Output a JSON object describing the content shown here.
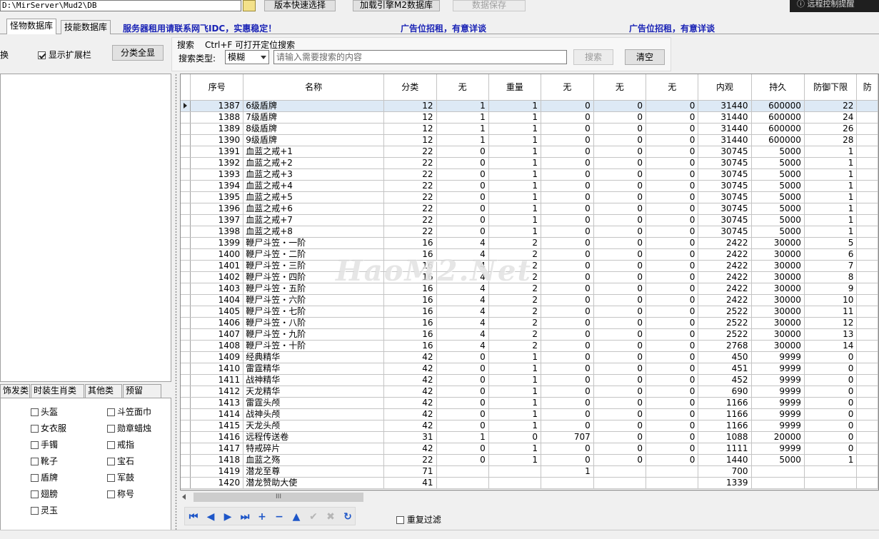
{
  "topbar": {
    "path": "D:\\MirServer\\Mud2\\DB",
    "btn_version": "版本快速选择",
    "btn_load": "加载引擎M2数据库",
    "btn_save": "数据保存",
    "remote": "远程控制提醒"
  },
  "tabs": [
    "怪物数据库",
    "技能数据库"
  ],
  "ads": [
    "服务器租用请联系网飞IDC，实惠稳定！",
    "广告位招租，有意详谈",
    "广告位招租，有意详谈"
  ],
  "toolbar": {
    "swap_label": "换",
    "show_ext_label": "显示扩展栏",
    "show_ext_checked": true,
    "expand_all": "分类全显",
    "search_title": "搜索",
    "search_hint": "Ctrl+F 可打开定位搜索",
    "search_type_label": "搜索类型:",
    "search_type_value": "模糊",
    "search_placeholder": "请输入需要搜索的内容",
    "search_btn": "搜索",
    "clear_btn": "清空"
  },
  "left_tabs": [
    "饰发类",
    "时装生肖类",
    "其他类",
    "预留"
  ],
  "categories": [
    [
      "头盔",
      "斗笠面巾"
    ],
    [
      "女衣服",
      "勋章蜡烛"
    ],
    [
      "手镯",
      "戒指"
    ],
    [
      "靴子",
      "宝石"
    ],
    [
      "盾牌",
      "军鼓"
    ],
    [
      "翅膀",
      "称号"
    ],
    [
      "灵玉",
      ""
    ]
  ],
  "grid": {
    "headers": [
      "序号",
      "名称",
      "分类",
      "无",
      "重量",
      "无",
      "无",
      "无",
      "内观",
      "持久",
      "防御下限",
      "防"
    ],
    "rows": [
      [
        "1387",
        "6级盾牌",
        "12",
        "1",
        "1",
        "0",
        "0",
        "0",
        "31440",
        "600000",
        "22"
      ],
      [
        "1388",
        "7级盾牌",
        "12",
        "1",
        "1",
        "0",
        "0",
        "0",
        "31440",
        "600000",
        "24"
      ],
      [
        "1389",
        "8级盾牌",
        "12",
        "1",
        "1",
        "0",
        "0",
        "0",
        "31440",
        "600000",
        "26"
      ],
      [
        "1390",
        "9级盾牌",
        "12",
        "1",
        "1",
        "0",
        "0",
        "0",
        "31440",
        "600000",
        "28"
      ],
      [
        "1391",
        "血蓝之戒+1",
        "22",
        "0",
        "1",
        "0",
        "0",
        "0",
        "30745",
        "5000",
        "1"
      ],
      [
        "1392",
        "血蓝之戒+2",
        "22",
        "0",
        "1",
        "0",
        "0",
        "0",
        "30745",
        "5000",
        "1"
      ],
      [
        "1393",
        "血蓝之戒+3",
        "22",
        "0",
        "1",
        "0",
        "0",
        "0",
        "30745",
        "5000",
        "1"
      ],
      [
        "1394",
        "血蓝之戒+4",
        "22",
        "0",
        "1",
        "0",
        "0",
        "0",
        "30745",
        "5000",
        "1"
      ],
      [
        "1395",
        "血蓝之戒+5",
        "22",
        "0",
        "1",
        "0",
        "0",
        "0",
        "30745",
        "5000",
        "1"
      ],
      [
        "1396",
        "血蓝之戒+6",
        "22",
        "0",
        "1",
        "0",
        "0",
        "0",
        "30745",
        "5000",
        "1"
      ],
      [
        "1397",
        "血蓝之戒+7",
        "22",
        "0",
        "1",
        "0",
        "0",
        "0",
        "30745",
        "5000",
        "1"
      ],
      [
        "1398",
        "血蓝之戒+8",
        "22",
        "0",
        "1",
        "0",
        "0",
        "0",
        "30745",
        "5000",
        "1"
      ],
      [
        "1399",
        "鞭尸斗笠・一阶",
        "16",
        "4",
        "2",
        "0",
        "0",
        "0",
        "2422",
        "30000",
        "5"
      ],
      [
        "1400",
        "鞭尸斗笠・二阶",
        "16",
        "4",
        "2",
        "0",
        "0",
        "0",
        "2422",
        "30000",
        "6"
      ],
      [
        "1401",
        "鞭尸斗笠・三阶",
        "16",
        "4",
        "2",
        "0",
        "0",
        "0",
        "2422",
        "30000",
        "7"
      ],
      [
        "1402",
        "鞭尸斗笠・四阶",
        "16",
        "4",
        "2",
        "0",
        "0",
        "0",
        "2422",
        "30000",
        "8"
      ],
      [
        "1403",
        "鞭尸斗笠・五阶",
        "16",
        "4",
        "2",
        "0",
        "0",
        "0",
        "2422",
        "30000",
        "9"
      ],
      [
        "1404",
        "鞭尸斗笠・六阶",
        "16",
        "4",
        "2",
        "0",
        "0",
        "0",
        "2422",
        "30000",
        "10"
      ],
      [
        "1405",
        "鞭尸斗笠・七阶",
        "16",
        "4",
        "2",
        "0",
        "0",
        "0",
        "2522",
        "30000",
        "11"
      ],
      [
        "1406",
        "鞭尸斗笠・八阶",
        "16",
        "4",
        "2",
        "0",
        "0",
        "0",
        "2522",
        "30000",
        "12"
      ],
      [
        "1407",
        "鞭尸斗笠・九阶",
        "16",
        "4",
        "2",
        "0",
        "0",
        "0",
        "2522",
        "30000",
        "13"
      ],
      [
        "1408",
        "鞭尸斗笠・十阶",
        "16",
        "4",
        "2",
        "0",
        "0",
        "0",
        "2768",
        "30000",
        "14"
      ],
      [
        "1409",
        "经典精华",
        "42",
        "0",
        "1",
        "0",
        "0",
        "0",
        "450",
        "9999",
        "0"
      ],
      [
        "1410",
        "雷霆精华",
        "42",
        "0",
        "1",
        "0",
        "0",
        "0",
        "451",
        "9999",
        "0"
      ],
      [
        "1411",
        "战神精华",
        "42",
        "0",
        "1",
        "0",
        "0",
        "0",
        "452",
        "9999",
        "0"
      ],
      [
        "1412",
        "天龙精华",
        "42",
        "0",
        "1",
        "0",
        "0",
        "0",
        "690",
        "9999",
        "0"
      ],
      [
        "1413",
        "雷霆头颅",
        "42",
        "0",
        "1",
        "0",
        "0",
        "0",
        "1166",
        "9999",
        "0"
      ],
      [
        "1414",
        "战神头颅",
        "42",
        "0",
        "1",
        "0",
        "0",
        "0",
        "1166",
        "9999",
        "0"
      ],
      [
        "1415",
        "天龙头颅",
        "42",
        "0",
        "1",
        "0",
        "0",
        "0",
        "1166",
        "9999",
        "0"
      ],
      [
        "1416",
        "远程传送卷",
        "31",
        "1",
        "0",
        "707",
        "0",
        "0",
        "1088",
        "20000",
        "0"
      ],
      [
        "1417",
        "特戒碎片",
        "42",
        "0",
        "1",
        "0",
        "0",
        "0",
        "1111",
        "9999",
        "0"
      ],
      [
        "1418",
        "血蓝之殇",
        "22",
        "0",
        "1",
        "0",
        "0",
        "0",
        "1440",
        "5000",
        "1"
      ],
      [
        "1419",
        "潜龙至尊",
        "71",
        "",
        "",
        "1",
        "",
        "",
        "700",
        "",
        ""
      ],
      [
        "1420",
        "潜龙赞助大使",
        "41",
        "",
        "",
        "",
        "",
        "",
        "1339",
        "",
        ""
      ]
    ]
  },
  "scroll_thumb": "III",
  "watermark": "HaoM2.Net",
  "repeat_filter": "重复过滤",
  "nav_icons": [
    "first-icon",
    "prior-icon",
    "next-icon",
    "last-icon",
    "insert-icon",
    "delete-icon",
    "edit-icon",
    "post-icon",
    "cancel-icon",
    "refresh-icon"
  ]
}
